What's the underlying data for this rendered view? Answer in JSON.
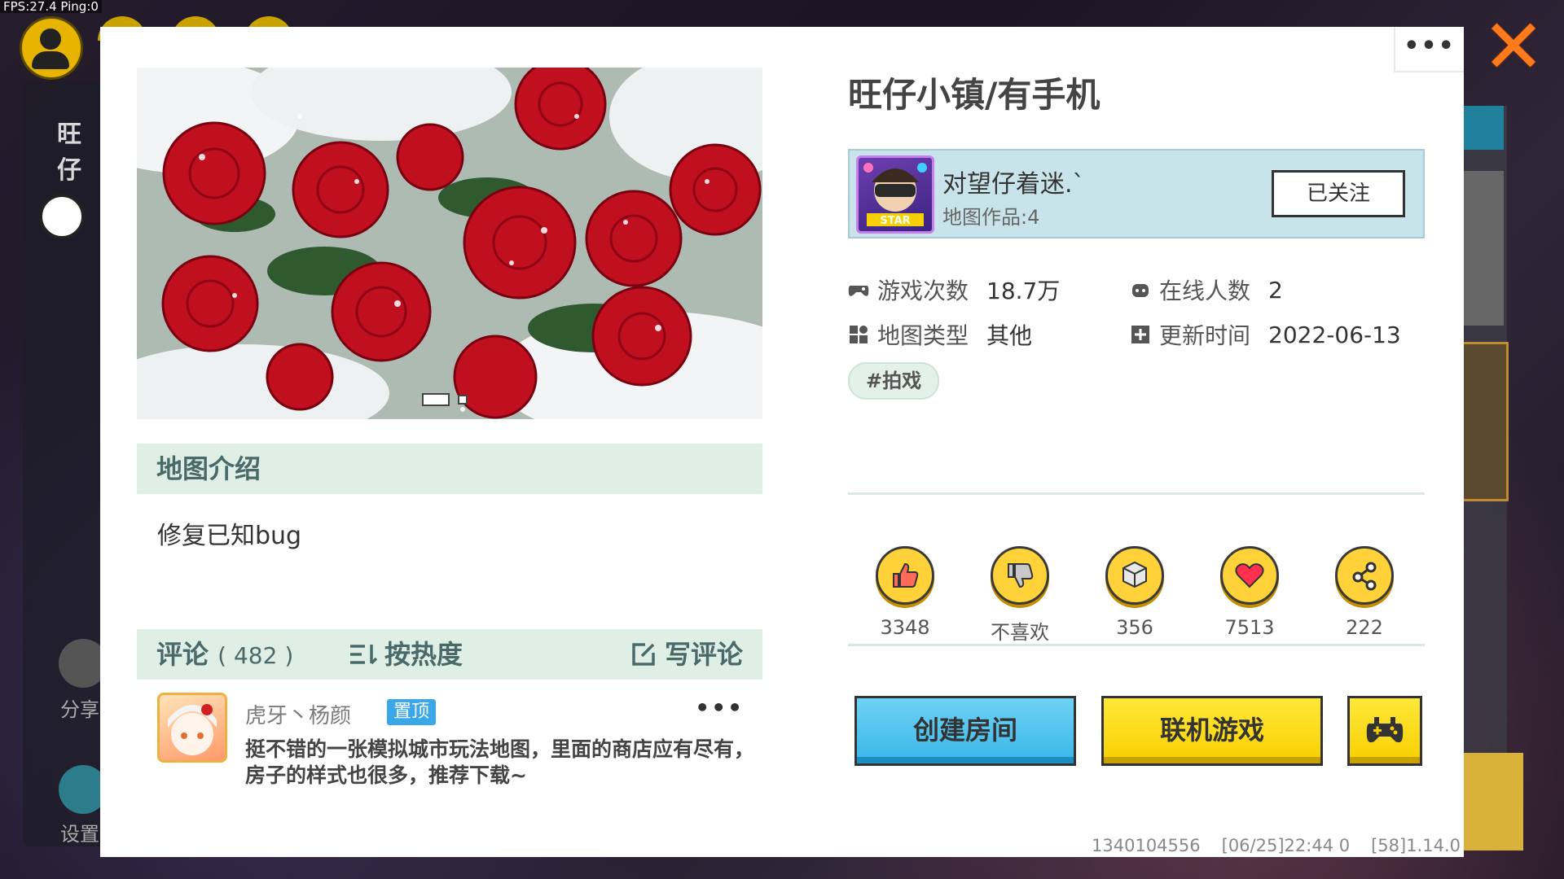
{
  "hud": {
    "fps_text": "FPS:27.4  Ping:0"
  },
  "background": {
    "left_title": "旺仔",
    "share_label": "分享",
    "settings_label": "设置"
  },
  "dialog": {
    "more_label": "•••",
    "close_label": "✕",
    "cover_pager": {
      "current": 1,
      "total": 2
    },
    "intro": {
      "title": "地图介绍",
      "text": "修复已知bug"
    },
    "comments": {
      "title": "评论",
      "count": "( 482 )",
      "sort_label": "按热度",
      "write_label": "写评论",
      "items": [
        {
          "user": "虎牙丶杨颜",
          "badge": "置顶",
          "more": "•••",
          "text": "挺不错的一张模拟城市玩法地图，里面的商店应有尽有，房子的样式也很多，推荐下载~"
        }
      ]
    },
    "map_title": "旺仔小镇/有手机",
    "author": {
      "name": "对望仔着迷.`",
      "works": "地图作品:4",
      "follow_label": "已关注",
      "avatar_text": "STAR"
    },
    "stats": {
      "plays_label": "游戏次数",
      "plays_value": "18.7万",
      "online_label": "在线人数",
      "online_value": "2",
      "type_label": "地图类型",
      "type_value": "其他",
      "updated_label": "更新时间",
      "updated_value": "2022-06-13"
    },
    "tag": "#拍戏",
    "actions": [
      {
        "name": "like",
        "value": "3348",
        "icon": "thumbs-up-icon"
      },
      {
        "name": "dislike",
        "value": "不喜欢",
        "icon": "thumbs-down-icon"
      },
      {
        "name": "download",
        "value": "356",
        "icon": "download-icon"
      },
      {
        "name": "favorite",
        "value": "7513",
        "icon": "heart-icon"
      },
      {
        "name": "share",
        "value": "222",
        "icon": "share-icon"
      }
    ],
    "buttons": {
      "create_room": "创建房间",
      "online_game": "联机游戏"
    },
    "footer": {
      "id": "1340104556",
      "time": "[06/25]22:44 0",
      "version": "[58]1.14.0"
    }
  },
  "colors": {
    "accent_yellow": "#ffd23a",
    "accent_blue": "#38b6e8",
    "close_orange": "#ff7a1a",
    "section_bg": "#e0efe6"
  }
}
